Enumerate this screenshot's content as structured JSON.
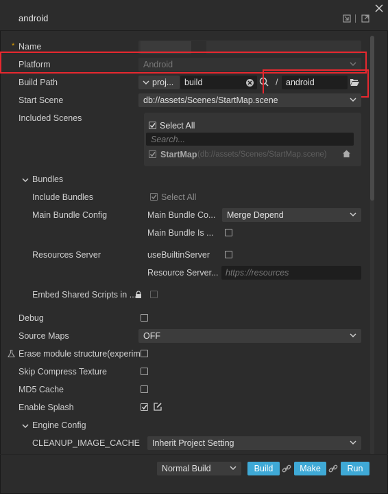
{
  "window": {
    "title": "android"
  },
  "fields": {
    "name_label": "Name",
    "name_required": "*",
    "platform_label": "Platform",
    "platform_value": "Android",
    "build_path_label": "Build Path",
    "build_path_prefix": "proj...",
    "build_path_dir": "build",
    "build_path_sep": "/",
    "build_path_name": "android",
    "start_scene_label": "Start Scene",
    "start_scene_value": "db://assets/Scenes/StartMap.scene",
    "included_scenes_label": "Included Scenes",
    "select_all": "Select All",
    "search_placeholder": "Search...",
    "scene_name": "StartMap",
    "scene_path": "(db://assets/Scenes/StartMap.scene)"
  },
  "bundles": {
    "header": "Bundles",
    "include_label": "Include Bundles",
    "include_select_all": "Select All",
    "main_config_label": "Main Bundle Config",
    "main_compression_label": "Main Bundle Co...",
    "main_compression_value": "Merge Depend",
    "main_is_remote_label": "Main Bundle Is ...",
    "resources_server_label": "Resources Server",
    "use_builtin_label": "useBuiltinServer",
    "resource_server_label": "Resource Server...",
    "resource_server_placeholder": "https://resources",
    "embed_label": "Embed Shared Scripts in ..."
  },
  "options": {
    "debug_label": "Debug",
    "source_maps_label": "Source Maps",
    "source_maps_value": "OFF",
    "erase_label": "Erase module structure(experim",
    "skip_compress_label": "Skip Compress Texture",
    "md5_label": "MD5 Cache",
    "splash_label": "Enable Splash",
    "engine_config_header": "Engine Config",
    "cleanup_label": "CLEANUP_IMAGE_CACHE",
    "cleanup_value": "Inherit Project Setting"
  },
  "footer": {
    "build_mode": "Normal Build",
    "build_button": "Build",
    "make_button": "Make",
    "run_button": "Run"
  },
  "colors": {
    "accent": "#3fa9d6",
    "highlight": "#e8282f",
    "required": "#e0a000"
  }
}
